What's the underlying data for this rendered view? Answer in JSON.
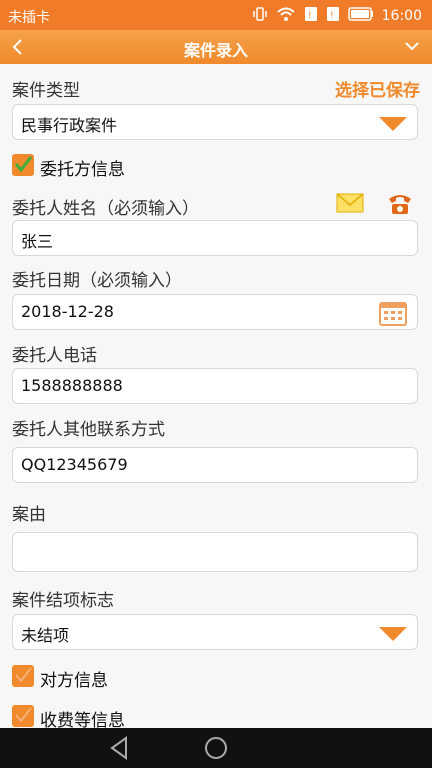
{
  "status": {
    "carrier": "未插卡",
    "time": "16:00"
  },
  "titlebar": {
    "title": "案件录入"
  },
  "case_type": {
    "label": "案件类型",
    "saved_link": "选择已保存",
    "value": "民事行政案件"
  },
  "client_section": {
    "label": "委托方信息"
  },
  "client_name": {
    "label": "委托人姓名（必须输入）",
    "value": "张三"
  },
  "client_date": {
    "label": "委托日期（必须输入）",
    "value": "2018-12-28"
  },
  "client_phone": {
    "label": "委托人电话",
    "value": "1588888888"
  },
  "client_other": {
    "label": "委托人其他联系方式",
    "value": "QQ12345679"
  },
  "case_reason": {
    "label": "案由",
    "value": ""
  },
  "case_status": {
    "label": "案件结项标志",
    "value": "未结项"
  },
  "opponent_section": {
    "label": "对方信息"
  },
  "fee_section": {
    "label": "收费等信息"
  },
  "colors": {
    "accent": "#f08a2c",
    "title_bg": "#f4a24a"
  },
  "icons": [
    "back-icon",
    "menu-chevron-icon",
    "dropdown-arrow-icon",
    "checkbox-icon",
    "mail-icon",
    "phone-icon",
    "calendar-icon",
    "nav-back-icon",
    "nav-home-icon"
  ]
}
